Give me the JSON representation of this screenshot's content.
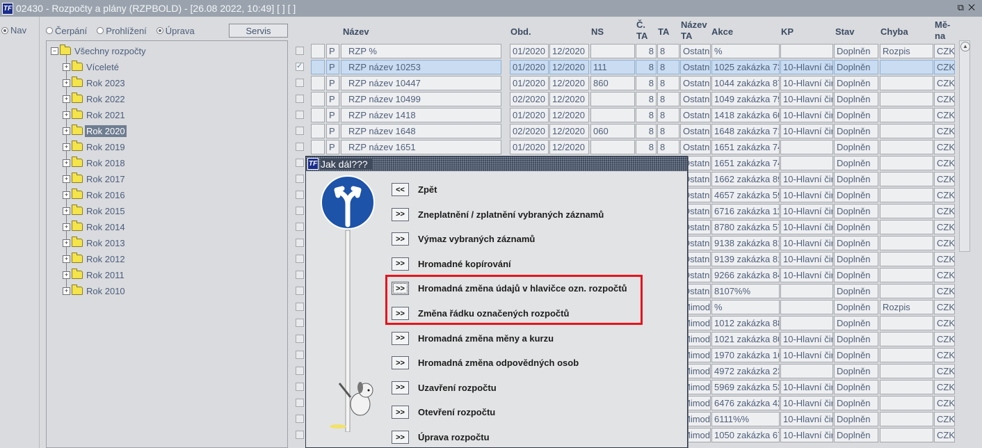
{
  "window": {
    "title": "02430 - Rozpočty a plány (RZPBOLD) - [26.08 2022, 10:49]   [ ]  [ ]",
    "logo_text": "TF",
    "controls": "⧉✕"
  },
  "leftnav": {
    "nav_label": "Nav"
  },
  "modes": [
    {
      "label": "Čerpání",
      "selected": false
    },
    {
      "label": "Prohlížení",
      "selected": false
    },
    {
      "label": "Úprava",
      "selected": true
    }
  ],
  "servis_label": "Servis",
  "tree": {
    "root": "Všechny rozpočty",
    "items": [
      "Víceleté",
      "Rok 2023",
      "Rok 2022",
      "Rok 2021",
      "Rok 2020",
      "Rok 2019",
      "Rok 2018",
      "Rok 2017",
      "Rok 2016",
      "Rok 2015",
      "Rok 2014",
      "Rok 2013",
      "Rok 2012",
      "Rok 2011",
      "Rok 2010"
    ],
    "selected": "Rok 2020"
  },
  "grid": {
    "headers": {
      "nazev": "Název",
      "obd": "Obd.",
      "ns": "NS",
      "cta": "Č. TA",
      "ta": "TA",
      "nazev_ta": "Název TA",
      "akce": "Akce",
      "kp": "KP",
      "stav": "Stav",
      "chyba": "Chyba",
      "mena": "Mě- na"
    },
    "rows": [
      {
        "type": "P",
        "nazev": "RZP %",
        "od": "01/2020",
        "do": "12/2020",
        "ns": "",
        "cta": "8",
        "ta": "8",
        "nta": "Ostatn",
        "akce": "%",
        "kp": "",
        "stav": "Doplněn",
        "chyba": "Rozpis",
        "mena": "CZK",
        "checked": false,
        "selected": false
      },
      {
        "type": "P",
        "nazev": "RZP název 10253",
        "od": "01/2020",
        "do": "12/2020",
        "ns": "111",
        "cta": "8",
        "ta": "8",
        "nta": "Ostatn",
        "akce": "1025 zakázka 73",
        "kp": "10-Hlavní čin",
        "stav": "Doplněn",
        "chyba": "",
        "mena": "CZK",
        "checked": true,
        "selected": true
      },
      {
        "type": "P",
        "nazev": "RZP název 10447",
        "od": "01/2020",
        "do": "12/2020",
        "ns": "860",
        "cta": "8",
        "ta": "8",
        "nta": "Ostatn",
        "akce": "1044 zakázka 87",
        "kp": "10-Hlavní čin",
        "stav": "Doplněn",
        "chyba": "",
        "mena": "CZK",
        "checked": false,
        "selected": false
      },
      {
        "type": "P",
        "nazev": "RZP název 10499",
        "od": "02/2020",
        "do": "12/2020",
        "ns": "",
        "cta": "8",
        "ta": "8",
        "nta": "Ostatn",
        "akce": "1049 zakázka 79",
        "kp": "10-Hlavní čin",
        "stav": "Doplněn",
        "chyba": "",
        "mena": "CZK",
        "checked": false,
        "selected": false
      },
      {
        "type": "P",
        "nazev": "RZP název 1418",
        "od": "01/2020",
        "do": "12/2020",
        "ns": "",
        "cta": "8",
        "ta": "8",
        "nta": "Ostatn",
        "akce": "1418 zakázka 60",
        "kp": "10-Hlavní čin",
        "stav": "Doplněn",
        "chyba": "",
        "mena": "CZK",
        "checked": false,
        "selected": false
      },
      {
        "type": "P",
        "nazev": "RZP název 1648",
        "od": "02/2020",
        "do": "12/2020",
        "ns": "060",
        "cta": "8",
        "ta": "8",
        "nta": "Ostatn",
        "akce": "1648 zakázka 71",
        "kp": "10-Hlavní čin",
        "stav": "Doplněn",
        "chyba": "",
        "mena": "CZK",
        "checked": false,
        "selected": false
      },
      {
        "type": "P",
        "nazev": "RZP název 1651",
        "od": "01/2020",
        "do": "12/2020",
        "ns": "",
        "cta": "8",
        "ta": "8",
        "nta": "Ostatn",
        "akce": "1651 zakázka 74",
        "kp": "",
        "stav": "Doplněn",
        "chyba": "",
        "mena": "CZK",
        "checked": false,
        "selected": false
      },
      {
        "type": "",
        "nazev": "",
        "od": "",
        "do": "",
        "ns": "",
        "cta": "",
        "ta": "",
        "nta": "Ostatn",
        "akce": "1651 zakázka 74",
        "kp": "",
        "stav": "Doplněn",
        "chyba": "",
        "mena": "CZK",
        "checked": false,
        "selected": false
      },
      {
        "type": "",
        "nazev": "",
        "od": "",
        "do": "",
        "ns": "",
        "cta": "",
        "ta": "",
        "nta": "Ostatn",
        "akce": "1662 zakázka 89",
        "kp": "10-Hlavní čin",
        "stav": "Doplněn",
        "chyba": "",
        "mena": "CZK",
        "checked": false,
        "selected": false
      },
      {
        "type": "",
        "nazev": "",
        "od": "",
        "do": "",
        "ns": "",
        "cta": "",
        "ta": "",
        "nta": "Ostatn",
        "akce": "4657 zakázka 59",
        "kp": "10-Hlavní čin",
        "stav": "Doplněn",
        "chyba": "",
        "mena": "CZK",
        "checked": false,
        "selected": false
      },
      {
        "type": "",
        "nazev": "",
        "od": "",
        "do": "",
        "ns": "",
        "cta": "",
        "ta": "",
        "nta": "Ostatn",
        "akce": "6716 zakázka 11",
        "kp": "10-Hlavní čin",
        "stav": "Doplněn",
        "chyba": "",
        "mena": "CZK",
        "checked": false,
        "selected": false
      },
      {
        "type": "",
        "nazev": "",
        "od": "",
        "do": "",
        "ns": "",
        "cta": "",
        "ta": "",
        "nta": "Ostatn",
        "akce": "8780 zakázka 57",
        "kp": "10-Hlavní čin",
        "stav": "Doplněn",
        "chyba": "",
        "mena": "CZK",
        "checked": false,
        "selected": false
      },
      {
        "type": "",
        "nazev": "",
        "od": "",
        "do": "",
        "ns": "",
        "cta": "",
        "ta": "",
        "nta": "Ostatn",
        "akce": "9138 zakázka 81",
        "kp": "10-Hlavní čin",
        "stav": "Doplněn",
        "chyba": "",
        "mena": "CZK",
        "checked": false,
        "selected": false
      },
      {
        "type": "",
        "nazev": "",
        "od": "",
        "do": "",
        "ns": "",
        "cta": "",
        "ta": "",
        "nta": "Ostatn",
        "akce": "9139 zakázka 81",
        "kp": "10-Hlavní čin",
        "stav": "Doplněn",
        "chyba": "",
        "mena": "CZK",
        "checked": false,
        "selected": false
      },
      {
        "type": "",
        "nazev": "",
        "od": "",
        "do": "",
        "ns": "",
        "cta": "",
        "ta": "",
        "nta": "Ostatn",
        "akce": "9266 zakázka 84",
        "kp": "10-Hlavní čin",
        "stav": "Doplněn",
        "chyba": "",
        "mena": "CZK",
        "checked": false,
        "selected": false
      },
      {
        "type": "",
        "nazev": "",
        "od": "",
        "do": "",
        "ns": "",
        "cta": "",
        "ta": "",
        "nta": "Ostatn",
        "akce": "8107%%",
        "kp": "",
        "stav": "Doplněn",
        "chyba": "",
        "mena": "CZK",
        "checked": false,
        "selected": false
      },
      {
        "type": "",
        "nazev": "",
        "od": "",
        "do": "",
        "ns": "",
        "cta": "",
        "ta": "",
        "nta": "Mimod",
        "akce": "%",
        "kp": "",
        "stav": "Doplněn",
        "chyba": "Rozpis",
        "mena": "CZK",
        "checked": false,
        "selected": false
      },
      {
        "type": "",
        "nazev": "",
        "od": "",
        "do": "",
        "ns": "",
        "cta": "",
        "ta": "",
        "nta": "Mimod",
        "akce": "1012 zakázka 88",
        "kp": "",
        "stav": "Doplněn",
        "chyba": "",
        "mena": "CZK",
        "checked": false,
        "selected": false
      },
      {
        "type": "",
        "nazev": "",
        "od": "",
        "do": "",
        "ns": "",
        "cta": "",
        "ta": "",
        "nta": "Mimod",
        "akce": "1021 zakázka 80",
        "kp": "10-Hlavní čin",
        "stav": "Doplněn",
        "chyba": "",
        "mena": "CZK",
        "checked": false,
        "selected": false
      },
      {
        "type": "",
        "nazev": "",
        "od": "",
        "do": "",
        "ns": "",
        "cta": "",
        "ta": "",
        "nta": "Mimod",
        "akce": "1970 zakázka 16",
        "kp": "10-Hlavní čin",
        "stav": "Doplněn",
        "chyba": "",
        "mena": "CZK",
        "checked": false,
        "selected": false
      },
      {
        "type": "",
        "nazev": "",
        "od": "",
        "do": "",
        "ns": "",
        "cta": "",
        "ta": "",
        "nta": "Mimod",
        "akce": "4972 zakázka 23",
        "kp": "",
        "stav": "Doplněn",
        "chyba": "",
        "mena": "CZK",
        "checked": false,
        "selected": false
      },
      {
        "type": "",
        "nazev": "",
        "od": "",
        "do": "",
        "ns": "",
        "cta": "",
        "ta": "",
        "nta": "Mimod",
        "akce": "5969 zakázka 53",
        "kp": "10-Hlavní čin",
        "stav": "Doplněn",
        "chyba": "",
        "mena": "CZK",
        "checked": false,
        "selected": false
      },
      {
        "type": "",
        "nazev": "",
        "od": "",
        "do": "",
        "ns": "",
        "cta": "",
        "ta": "",
        "nta": "Mimod",
        "akce": "6476 zakázka 42",
        "kp": "10-Hlavní čin",
        "stav": "Doplněn",
        "chyba": "",
        "mena": "CZK",
        "checked": false,
        "selected": false
      },
      {
        "type": "",
        "nazev": "",
        "od": "",
        "do": "",
        "ns": "",
        "cta": "",
        "ta": "",
        "nta": "Mimod",
        "akce": "6111%%",
        "kp": "10-Hlavní čin",
        "stav": "Doplněn",
        "chyba": "",
        "mena": "CZK",
        "checked": false,
        "selected": false
      },
      {
        "type": "",
        "nazev": "",
        "od": "",
        "do": "",
        "ns": "",
        "cta": "",
        "ta": "",
        "nta": "Mimod",
        "akce": "1050 zakázka 67",
        "kp": "10-Hlavní čin",
        "stav": "Doplněn",
        "chyba": "",
        "mena": "CZK",
        "checked": false,
        "selected": false
      }
    ]
  },
  "dialog": {
    "title": "Jak dál???",
    "back_label": "<<",
    "forward_label": ">>",
    "actions": [
      {
        "label": "Zpět",
        "back": true
      },
      {
        "label": "Zneplatnění / zplatnění vybraných záznamů",
        "back": false
      },
      {
        "label": "Výmaz vybraných záznamů",
        "back": false
      },
      {
        "label": "Hromadné kopírování",
        "back": false
      },
      {
        "label": "Hromadná změna údajů v hlavičce ozn. rozpočtů",
        "back": false,
        "focused": true
      },
      {
        "label": "Změna řádku označených rozpočtů",
        "back": false
      },
      {
        "label": "Hromadná změna měny a kurzu",
        "back": false
      },
      {
        "label": "Hromadná změna odpovědných osob",
        "back": false
      },
      {
        "label": "Uzavření rozpočtu",
        "back": false
      },
      {
        "label": "Otevření rozpočtu",
        "back": false
      },
      {
        "label": "Úprava rozpočtu",
        "back": false
      }
    ]
  },
  "colors": {
    "highlight_box": "#e5141d",
    "selected_row": "#c9dcf1",
    "tree_selected": "#6f7d91"
  }
}
